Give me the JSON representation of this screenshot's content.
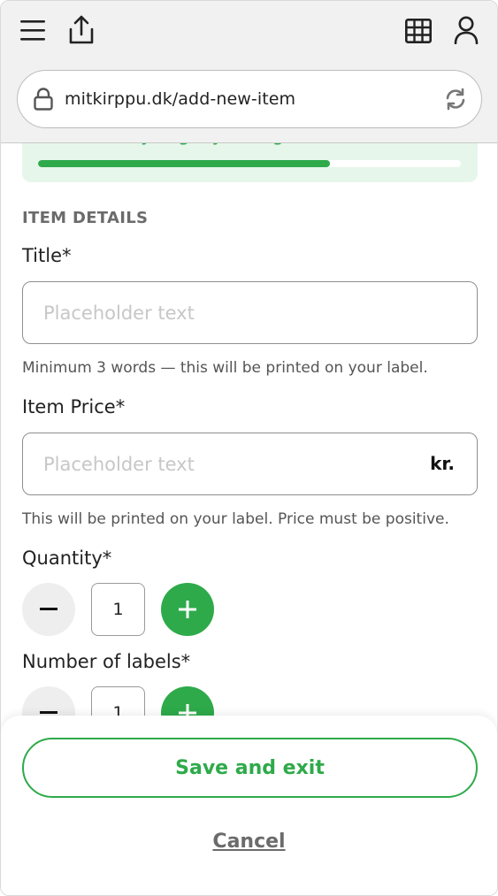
{
  "browser": {
    "url": "mitkirppu.dk/add-new-item"
  },
  "progress": {
    "text": "Almost ready to get your tags",
    "fraction": 0.69
  },
  "form": {
    "section_title": "ITEM DETAILS",
    "title_field": {
      "label": "Title*",
      "placeholder": "Placeholder text",
      "help": "Minimum 3 words — this will be printed on your label."
    },
    "price_field": {
      "label": "Item Price*",
      "placeholder": "Placeholder text",
      "suffix": "kr.",
      "help": "This will be printed on your label. Price must be positive."
    },
    "quantity": {
      "label": "Quantity*",
      "value": "1"
    },
    "labels_count": {
      "label": "Number of labels*",
      "value": "1"
    }
  },
  "actions": {
    "save_label": "Save and exit",
    "cancel_label": "Cancel"
  },
  "colors": {
    "accent": "#2eaa4a",
    "progress_bg": "#e7f6ea",
    "chrome_bg": "#f1f1f1"
  },
  "icons": [
    "menu-icon",
    "share-icon",
    "grid-icon",
    "user-icon",
    "lock-icon",
    "reload-icon",
    "minus-icon",
    "plus-icon"
  ]
}
